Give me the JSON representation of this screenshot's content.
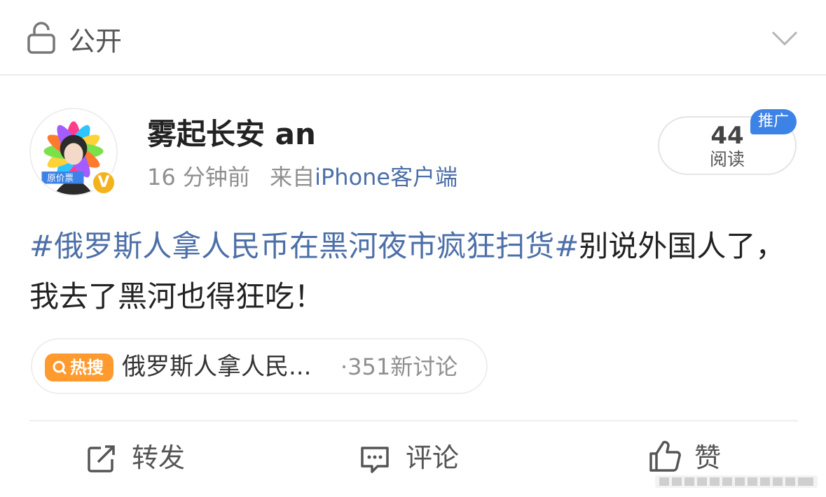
{
  "visibility": {
    "label": "公开",
    "icon": "unlock-icon"
  },
  "post": {
    "username": "雾起长安 an",
    "time": "16 分钟前",
    "source_prefix": "来自",
    "device": "iPhone客户端",
    "avatar_text": "原价票",
    "reads": {
      "count": "44",
      "label": "阅读"
    },
    "promo_tag": "推广",
    "hashtag": "#俄罗斯人拿人民币在黑河夜市疯狂扫货#",
    "body": "别说外国人了，我去了黑河也得狂吃！",
    "hot": {
      "badge": "热搜",
      "topic": "俄罗斯人拿人民...",
      "count": "·351新讨论"
    }
  },
  "actions": {
    "repost": "转发",
    "comment": "评论",
    "like": "赞"
  },
  "colors": {
    "link": "#4d6fa8",
    "hot_badge": "#ff9a2e",
    "promo": "#3d82e6",
    "verified": "#f4b31c"
  }
}
